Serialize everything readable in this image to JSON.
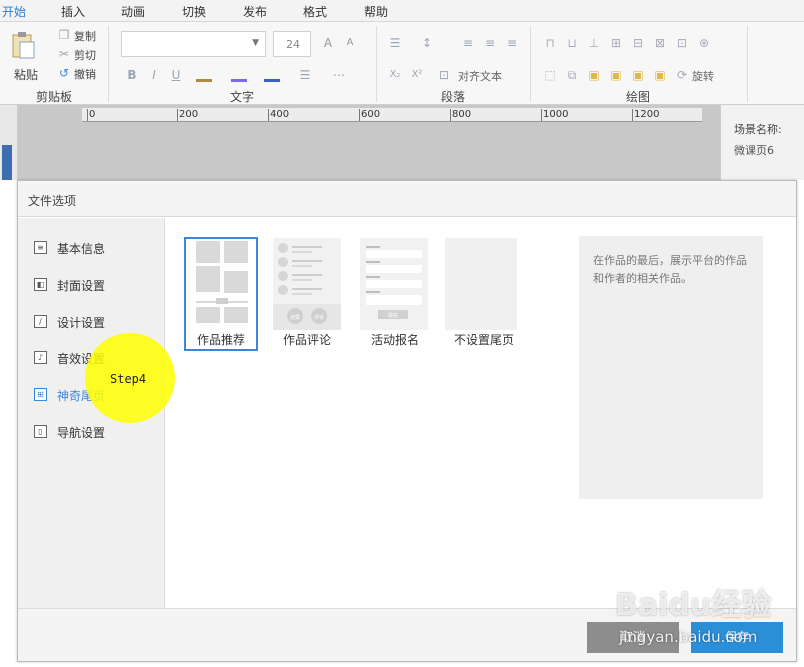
{
  "menubar": {
    "items": [
      "开始",
      "插入",
      "动画",
      "切换",
      "发布",
      "格式",
      "帮助"
    ],
    "active_index": 0
  },
  "ribbon": {
    "clipboard": {
      "paste": "粘贴",
      "copy": "复制",
      "cut": "剪切",
      "undo": "撤销",
      "group_label": "剪贴板"
    },
    "font": {
      "size": "24",
      "group_label": "文字"
    },
    "paragraph": {
      "align_text": "对齐文本",
      "group_label": "段落"
    },
    "drawing": {
      "rotate": "旋转",
      "group_label": "绘图"
    }
  },
  "ruler": {
    "labels": [
      "0",
      "200",
      "400",
      "600",
      "800",
      "1000",
      "1200"
    ]
  },
  "right_panel": {
    "scene_name_label": "场景名称:",
    "scene_name_value": "微课页6"
  },
  "dialog": {
    "title": "文件选项",
    "nav": [
      {
        "label": "基本信息",
        "icon": "list-icon"
      },
      {
        "label": "封面设置",
        "icon": "cover-icon"
      },
      {
        "label": "设计设置",
        "icon": "design-icon"
      },
      {
        "label": "音效设置",
        "icon": "music-icon"
      },
      {
        "label": "神奇尾页",
        "icon": "grid-icon"
      },
      {
        "label": "导航设置",
        "icon": "nav-icon"
      }
    ],
    "active_nav_index": 4,
    "templates": [
      {
        "label": "作品推荐",
        "selected": true
      },
      {
        "label": "作品评论",
        "selected": false
      },
      {
        "label": "活动报名",
        "selected": false
      },
      {
        "label": "不设置尾页",
        "selected": false
      }
    ],
    "template_mini": {
      "comment_btn_1": "点赞",
      "comment_btn_2": "评论",
      "signup_btn": "报名"
    },
    "description": "在作品的最后，展示平台的作品和作者的相关作品。",
    "cancel_label": "取消",
    "save_label": "保存"
  },
  "step": {
    "label": "Step4"
  },
  "watermark": {
    "logo": "Baidu经验",
    "url": "jingyan.baidu.com"
  },
  "colors": {
    "accent": "#3a86d9",
    "save_button": "#2b8fd8",
    "cancel_button": "#8d8d8d",
    "highlight": "#ffff00"
  }
}
